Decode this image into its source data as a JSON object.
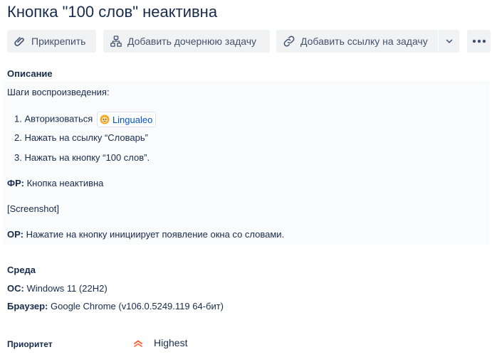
{
  "issue": {
    "title": "Кнопка \"100 слов\" неактивна"
  },
  "toolbar": {
    "attach_label": "Прикрепить",
    "add_child_label": "Добавить дочернюю задачу",
    "add_link_label": "Добавить ссылку на задачу"
  },
  "description": {
    "heading": "Описание",
    "steps_intro": "Шаги воспроизведения:",
    "steps": [
      {
        "num": "1.",
        "text": "Авторизоваться"
      },
      {
        "num": "2.",
        "text": "Нажать на ссылку “Словарь”"
      },
      {
        "num": "3.",
        "text": "Нажать на кнопку “100 слов”."
      }
    ],
    "smart_link_label": "Lingualeo",
    "fr_label": "ФР:",
    "fr_text": "Кнопка неактивна",
    "screenshot_text": "[Screenshot]",
    "or_label": "ОР:",
    "or_text": "Нажатие на кнопку инициирует появление окна со словами."
  },
  "environment": {
    "heading": "Среда",
    "os_label": "ОС:",
    "os_value": "Windows 11 (22H2)",
    "browser_label": "Браузер:",
    "browser_value": "Google Chrome (v106.0.5249.119 64-бит)"
  },
  "priority": {
    "label": "Приоритет",
    "value": "Highest",
    "color": "#ff5630"
  },
  "icons": {
    "attach": "paperclip-icon",
    "child": "hierarchy-icon",
    "link": "link-icon",
    "dropdown": "chevron-down-icon",
    "more": "more-icon",
    "smart_link": "lingualeo-favicon-icon",
    "priority": "highest-priority-icon"
  }
}
